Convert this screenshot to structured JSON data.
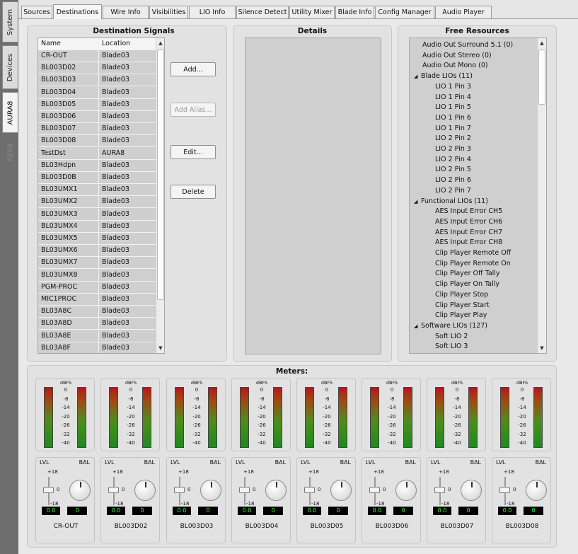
{
  "vertical_tabs": [
    {
      "label": "System"
    },
    {
      "label": "Devices"
    },
    {
      "label": "AURA8"
    },
    {
      "label": "AES6"
    }
  ],
  "tabs": [
    {
      "label": "Sources"
    },
    {
      "label": "Destinations"
    },
    {
      "label": "Wire Info"
    },
    {
      "label": "Visibilities"
    },
    {
      "label": "LIO Info"
    },
    {
      "label": "Silence Detect"
    },
    {
      "label": "Utility Mixer"
    },
    {
      "label": "Blade Info"
    },
    {
      "label": "Config Manager"
    },
    {
      "label": "Audio Player"
    }
  ],
  "destinations": {
    "title": "Destination Signals",
    "col_name": "Name",
    "col_location": "Location",
    "rows": [
      {
        "name": "CR-OUT",
        "loc": "Blade03"
      },
      {
        "name": "BL003D02",
        "loc": "Blade03"
      },
      {
        "name": "BL003D03",
        "loc": "Blade03"
      },
      {
        "name": "BL003D04",
        "loc": "Blade03"
      },
      {
        "name": "BL003D05",
        "loc": "Blade03"
      },
      {
        "name": "BL003D06",
        "loc": "Blade03"
      },
      {
        "name": "BL003D07",
        "loc": "Blade03"
      },
      {
        "name": "BL003D08",
        "loc": "Blade03"
      },
      {
        "name": "TestDst",
        "loc": "AURA8"
      },
      {
        "name": "BL03Hdpn",
        "loc": "Blade03"
      },
      {
        "name": "BL003D0B",
        "loc": "Blade03"
      },
      {
        "name": "BL03UMX1",
        "loc": "Blade03"
      },
      {
        "name": "BL03UMX2",
        "loc": "Blade03"
      },
      {
        "name": "BL03UMX3",
        "loc": "Blade03"
      },
      {
        "name": "BL03UMX4",
        "loc": "Blade03"
      },
      {
        "name": "BL03UMX5",
        "loc": "Blade03"
      },
      {
        "name": "BL03UMX6",
        "loc": "Blade03"
      },
      {
        "name": "BL03UMX7",
        "loc": "Blade03"
      },
      {
        "name": "BL03UMX8",
        "loc": "Blade03"
      },
      {
        "name": "PGM-PROC",
        "loc": "Blade03"
      },
      {
        "name": "MIC1PROC",
        "loc": "Blade03"
      },
      {
        "name": "BL03A8C",
        "loc": "Blade03"
      },
      {
        "name": "BL03A8D",
        "loc": "Blade03"
      },
      {
        "name": "BL03A8E",
        "loc": "Blade03"
      },
      {
        "name": "BL03A8F",
        "loc": "Blade03"
      }
    ]
  },
  "buttons": {
    "add": "Add...",
    "add_alias": "Add Alias...",
    "edit": "Edit...",
    "delete": "Delete"
  },
  "details": {
    "title": "Details"
  },
  "free_resources": {
    "title": "Free Resources",
    "items": [
      {
        "label": "Audio Out Surround 5.1 (0)",
        "level": 0
      },
      {
        "label": "Audio Out Stereo (0)",
        "level": 0
      },
      {
        "label": "Audio Out Mono (0)",
        "level": 0
      },
      {
        "label": "Blade LIOs (11)",
        "level": 0,
        "expander": "◢"
      },
      {
        "label": "LIO 1 Pin 3",
        "level": 1
      },
      {
        "label": "LIO 1 Pin 4",
        "level": 1
      },
      {
        "label": "LIO 1 Pin 5",
        "level": 1
      },
      {
        "label": "LIO 1 Pin 6",
        "level": 1
      },
      {
        "label": "LIO 1 Pin 7",
        "level": 1
      },
      {
        "label": "LIO 2 Pin 2",
        "level": 1
      },
      {
        "label": "LIO 2 Pin 3",
        "level": 1
      },
      {
        "label": "LIO 2 Pin 4",
        "level": 1
      },
      {
        "label": "LIO 2 Pin 5",
        "level": 1
      },
      {
        "label": "LIO 2 Pin 6",
        "level": 1
      },
      {
        "label": "LIO 2 Pin 7",
        "level": 1
      },
      {
        "label": "Functional LIOs (11)",
        "level": 0,
        "expander": "◢"
      },
      {
        "label": "AES Input Error CH5",
        "level": 1
      },
      {
        "label": "AES Input Error CH6",
        "level": 1
      },
      {
        "label": "AES Input Error CH7",
        "level": 1
      },
      {
        "label": "AES Input Error CH8",
        "level": 1
      },
      {
        "label": "Clip Player Remote Off",
        "level": 1
      },
      {
        "label": "Clip Player Remote On",
        "level": 1
      },
      {
        "label": "Clip Player Off Tally",
        "level": 1
      },
      {
        "label": "Clip Player On Tally",
        "level": 1
      },
      {
        "label": "Clip Player Stop",
        "level": 1
      },
      {
        "label": "Clip Player Start",
        "level": 1
      },
      {
        "label": "Clip Player Play",
        "level": 1
      },
      {
        "label": "Software LIOs (127)",
        "level": 0,
        "expander": "◢"
      },
      {
        "label": "Soft LIO 2",
        "level": 1
      },
      {
        "label": "Soft LIO 3",
        "level": 1
      }
    ]
  },
  "meters": {
    "title": "Meters:",
    "dbfs_label": "dBFS",
    "scale": [
      "0",
      "-8",
      "-14",
      "-20",
      "-26",
      "-32",
      "-40"
    ],
    "lvl_label": "LVL",
    "bal_label": "BAL",
    "fader_plus": "+18",
    "fader_zero": "0",
    "fader_minus": "-18",
    "channels": [
      {
        "name": "CR-OUT",
        "level": "0.0",
        "bal": "0"
      },
      {
        "name": "BL003D02",
        "level": "0.0",
        "bal": "0"
      },
      {
        "name": "BL003D03",
        "level": "0.0",
        "bal": "0"
      },
      {
        "name": "BL003D04",
        "level": "0.0",
        "bal": "0"
      },
      {
        "name": "BL003D05",
        "level": "0.0",
        "bal": "0"
      },
      {
        "name": "BL003D06",
        "level": "0.0",
        "bal": "0"
      },
      {
        "name": "BL003D07",
        "level": "0.0",
        "bal": "0"
      },
      {
        "name": "BL003D08",
        "level": "0.0",
        "bal": "0"
      }
    ]
  }
}
